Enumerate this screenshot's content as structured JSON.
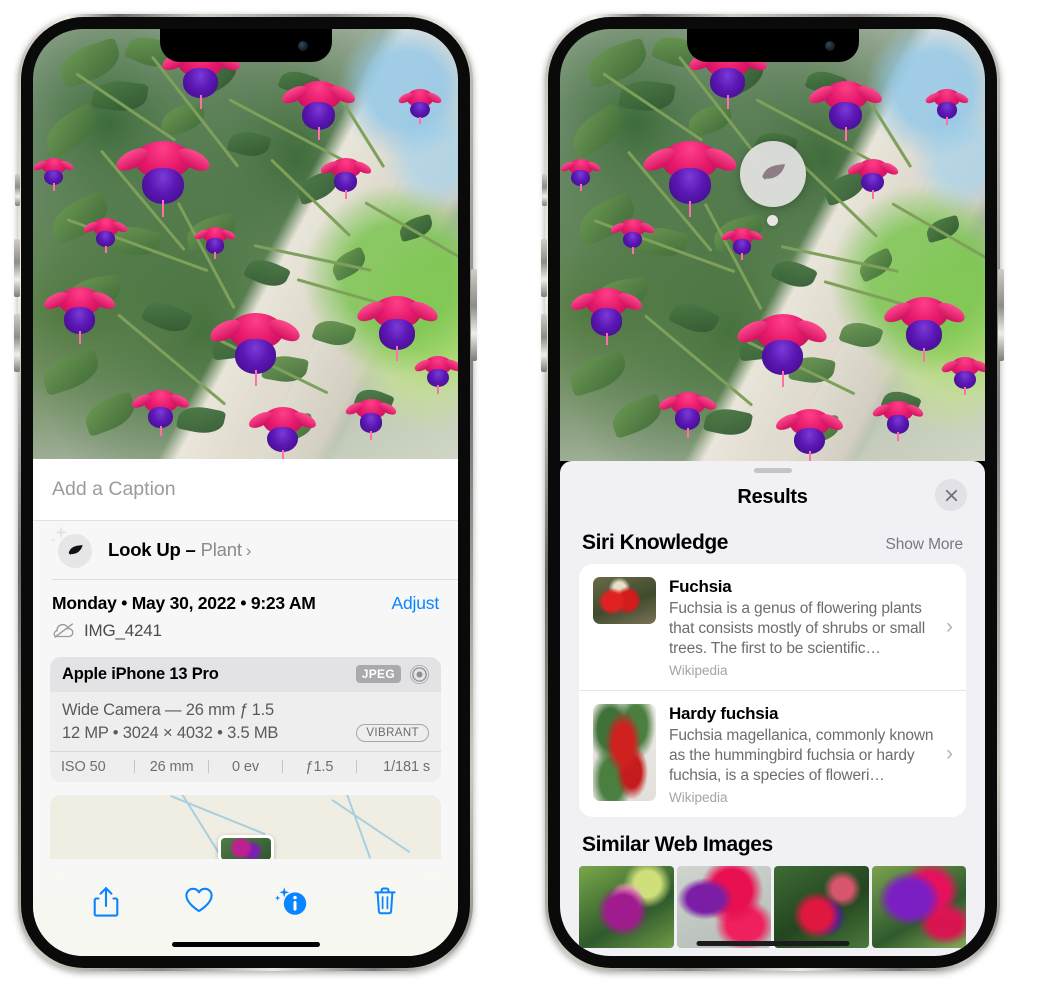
{
  "left_phone": {
    "name": "photos-info-view",
    "caption": {
      "placeholder": "Add a Caption",
      "value": ""
    },
    "lookup": {
      "label": "Look Up",
      "dash": "–",
      "subject": "Plant",
      "chevron": "›",
      "icon": "leaf-icon"
    },
    "date_row": {
      "date": "Monday • May 30, 2022 • 9:23 AM",
      "adjust_label": "Adjust"
    },
    "file_row": {
      "filename": "IMG_4241",
      "icon": "icloud-slash-icon"
    },
    "camera_card": {
      "device": "Apple iPhone 13 Pro",
      "format_badge": "JPEG",
      "lens_icon": "aperture-icon",
      "lens_line": "Wide Camera — 26 mm ƒ 1.5",
      "specs_line": "12 MP • 3024 × 4032 • 3.5 MB",
      "style_badge": "VIBRANT",
      "exif": [
        "ISO 50",
        "26 mm",
        "0 ev",
        "ƒ1.5",
        "1/181 s"
      ]
    },
    "toolbar": [
      {
        "name": "share-button",
        "icon": "share-icon"
      },
      {
        "name": "favorite-button",
        "icon": "heart-icon"
      },
      {
        "name": "info-button",
        "icon": "info-sparkle-icon"
      },
      {
        "name": "delete-button",
        "icon": "trash-icon"
      }
    ]
  },
  "right_phone": {
    "name": "visual-look-up-results",
    "badge": {
      "icon": "leaf-icon"
    },
    "sheet": {
      "title": "Results",
      "close_icon": "close-icon"
    },
    "siri_knowledge": {
      "title": "Siri Knowledge",
      "show_more": "Show More",
      "items": [
        {
          "title": "Fuchsia",
          "description": "Fuchsia is a genus of flowering plants that consists mostly of shrubs or small trees. The first to be scientific…",
          "source": "Wikipedia",
          "chevron": "›"
        },
        {
          "title": "Hardy fuchsia",
          "description": "Fuchsia magellanica, commonly known as the hummingbird fuchsia or hardy fuchsia, is a species of floweri…",
          "source": "Wikipedia",
          "chevron": "›"
        }
      ]
    },
    "similar_web_images": {
      "title": "Similar Web Images",
      "count": 4
    }
  },
  "colors": {
    "accent_blue": "#0a84ff",
    "sheet_bg": "#f1f0f5",
    "card_bg": "#ffffff",
    "secondary_text": "#6c6c72",
    "badge_gray": "#a9a9ae"
  }
}
